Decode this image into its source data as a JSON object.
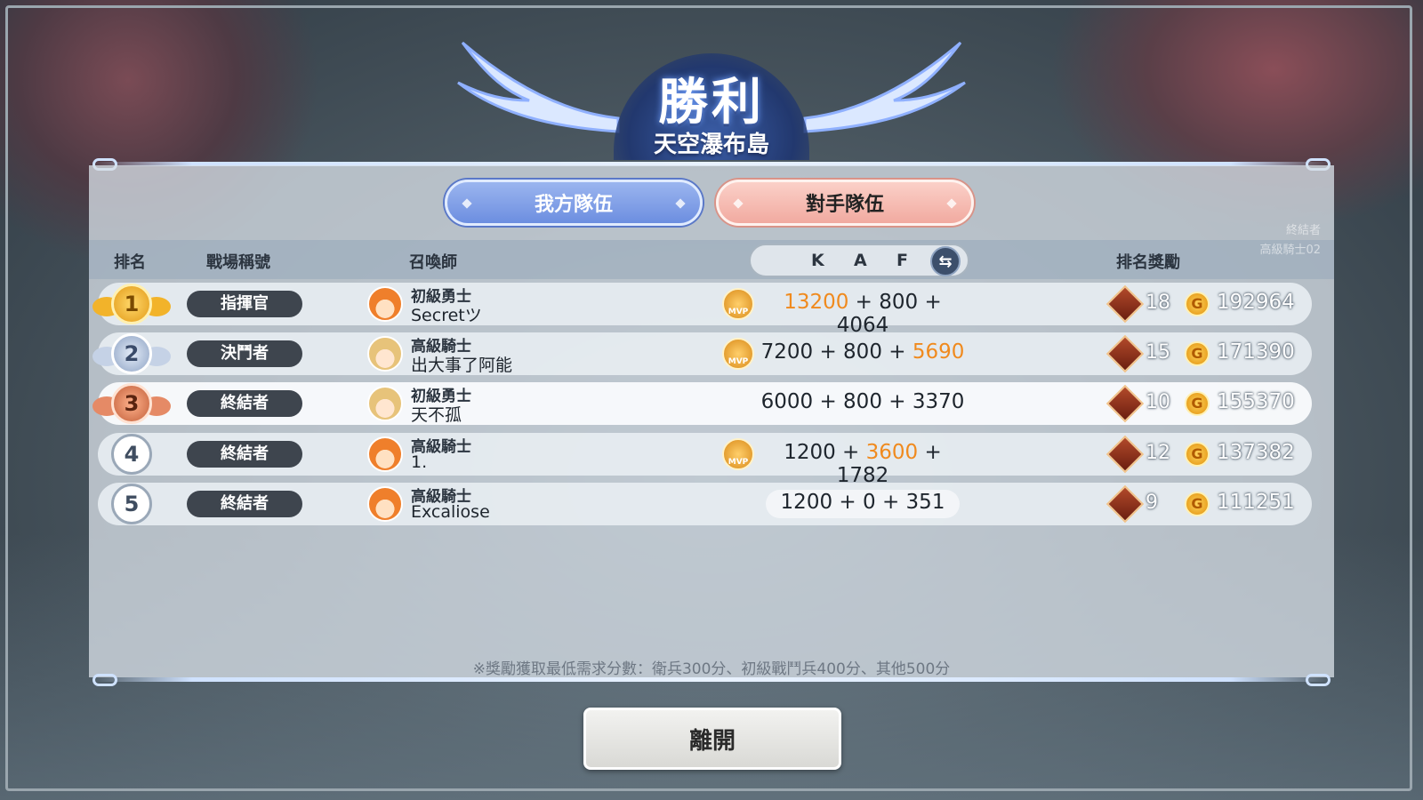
{
  "header": {
    "result": "勝利",
    "map_name": "天空瀑布島"
  },
  "tabs": [
    {
      "label": "我方隊伍",
      "active": true
    },
    {
      "label": "對手隊伍",
      "active": false
    }
  ],
  "columns": {
    "rank": "排名",
    "battle_title": "戰場稱號",
    "summoner": "召喚師",
    "k": "K",
    "a": "A",
    "f": "F",
    "reward": "排名獎勵"
  },
  "rows": [
    {
      "rank": "1",
      "medal": "gold",
      "title": "指揮官",
      "tier": "初級勇士",
      "name": "Secretツ",
      "mvp": "MVP",
      "score_parts": [
        "13200",
        "800",
        "4064"
      ],
      "highlight_index": 0,
      "reward_item": "18",
      "reward_gold": "192964"
    },
    {
      "rank": "2",
      "medal": "silver",
      "title": "決鬥者",
      "tier": "高級騎士",
      "name": "出大事了阿能",
      "mvp": "MVP",
      "score_parts": [
        "7200",
        "800",
        "5690"
      ],
      "highlight_index": 2,
      "reward_item": "15",
      "reward_gold": "171390"
    },
    {
      "rank": "3",
      "medal": "bronze",
      "title": "終結者",
      "tier": "初級勇士",
      "name": "天不孤",
      "mvp": "",
      "score_parts": [
        "6000",
        "800",
        "3370"
      ],
      "highlight_index": -1,
      "reward_item": "10",
      "reward_gold": "155370"
    },
    {
      "rank": "4",
      "medal": "plain",
      "title": "終結者",
      "tier": "高級騎士",
      "name": "1.",
      "mvp": "MVP",
      "score_parts": [
        "1200",
        "3600",
        "1782"
      ],
      "highlight_index": 1,
      "reward_item": "12",
      "reward_gold": "137382"
    },
    {
      "rank": "5",
      "medal": "plain",
      "title": "終結者",
      "tier": "高級騎士",
      "name": "Excaliose",
      "mvp": "",
      "score_parts": [
        "1200",
        "0",
        "351"
      ],
      "highlight_index": -1,
      "reward_item": "9",
      "reward_gold": "111251"
    }
  ],
  "plus": "+",
  "coin_glyph": "G",
  "note": "※獎勵獲取最低需求分數：衛兵300分、初級戰鬥兵400分、其他500分",
  "leave_button": "離開",
  "side_overlay": {
    "line1": "終結者",
    "line2": "高級騎士02"
  },
  "icons": {
    "rank_medal": "medal-icon",
    "avatar": "summoner-avatar-icon",
    "mvp": "mvp-badge-icon",
    "reward_item": "gem-crate-icon",
    "coin": "gold-coin-icon",
    "swap": "swap-arrows-icon"
  },
  "colors": {
    "highlight_score": "#f08a1e",
    "tab_mine": "#7b9ae4",
    "tab_enemy": "#f3b5ab"
  }
}
